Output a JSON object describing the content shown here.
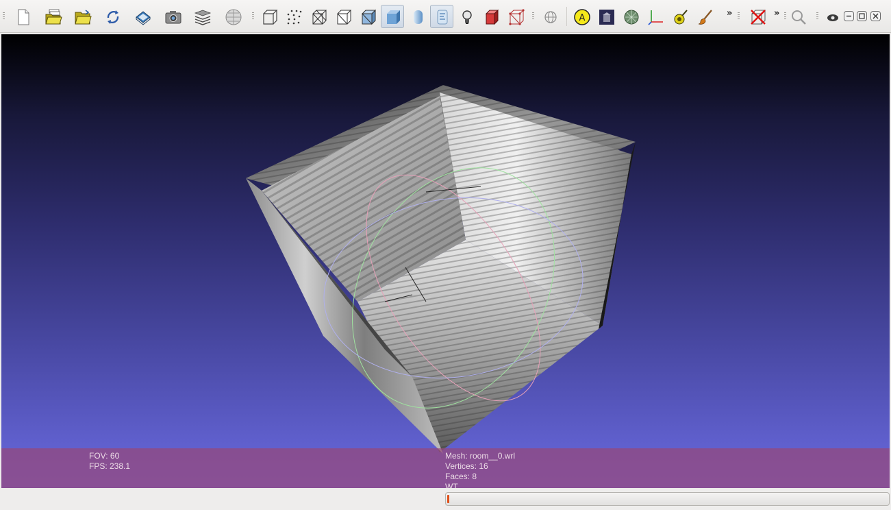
{
  "toolbar": {
    "buttons": [
      {
        "name": "new-project",
        "icon": "new-document-icon",
        "active": false
      },
      {
        "name": "open-project",
        "icon": "open-project-icon",
        "active": false
      },
      {
        "name": "import-mesh",
        "icon": "open-folder-icon",
        "active": false
      },
      {
        "name": "reload",
        "icon": "reload-icon",
        "active": false
      },
      {
        "name": "save",
        "icon": "save-icon",
        "active": false
      },
      {
        "name": "snapshot",
        "icon": "camera-icon",
        "active": false
      },
      {
        "name": "layers",
        "icon": "layers-icon",
        "active": false
      },
      {
        "name": "raster",
        "icon": "raster-globe-icon",
        "active": false
      },
      {
        "name": "bbox",
        "icon": "bounding-box-icon",
        "active": false
      },
      {
        "name": "points",
        "icon": "points-icon",
        "active": false
      },
      {
        "name": "wireframe",
        "icon": "wireframe-icon",
        "active": false
      },
      {
        "name": "hidden-lines",
        "icon": "hidden-lines-icon",
        "active": false
      },
      {
        "name": "flat-lines",
        "icon": "flat-lines-icon",
        "active": false
      },
      {
        "name": "flat",
        "icon": "flat-shading-icon",
        "active": true
      },
      {
        "name": "smooth",
        "icon": "smooth-shading-icon",
        "active": false
      },
      {
        "name": "texture",
        "icon": "texture-icon",
        "active": true
      },
      {
        "name": "lighting",
        "icon": "light-bulb-icon",
        "active": false
      },
      {
        "name": "backface",
        "icon": "backface-icon",
        "active": false
      },
      {
        "name": "selection",
        "icon": "selection-icon",
        "active": false
      },
      {
        "name": "globe",
        "icon": "globe-icon",
        "active": false
      },
      {
        "name": "annotate",
        "icon": "annotation-icon",
        "active": false
      },
      {
        "name": "gallery",
        "icon": "gallery-icon",
        "active": false
      },
      {
        "name": "mesh-filter",
        "icon": "mesh-filter-icon",
        "active": false
      },
      {
        "name": "axes",
        "icon": "axes-icon",
        "active": false
      },
      {
        "name": "pick",
        "icon": "pick-icon",
        "active": false
      },
      {
        "name": "paint",
        "icon": "paint-brush-icon",
        "active": false
      },
      {
        "name": "delete",
        "icon": "delete-icon",
        "active": false
      },
      {
        "name": "search",
        "icon": "search-icon",
        "active": false
      },
      {
        "name": "view",
        "icon": "eye-icon",
        "active": false
      }
    ],
    "more_label_1": "»",
    "more_label_2": "»",
    "window_controls": [
      "minimize-icon",
      "restore-icon",
      "close-icon"
    ]
  },
  "viewport": {
    "fov_label": "FOV: 60",
    "fps_label": "FPS:   238.1",
    "mesh_label": "Mesh: room__0.wrl",
    "vertices_label": "Vertices: 16",
    "faces_label": "Faces: 8",
    "extra_label": "WT",
    "background_top": "#000000",
    "background_bottom": "#6a6ae0",
    "overlay_color": "#8a4a80"
  },
  "statusbar": {
    "progress_fraction": 0.005,
    "progress_color": "#e0501a"
  }
}
